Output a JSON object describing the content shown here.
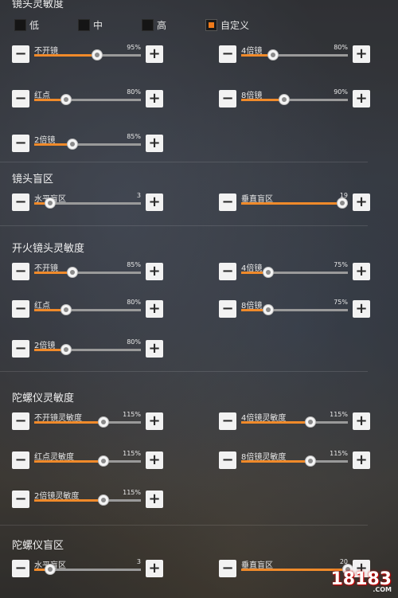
{
  "sections": {
    "scope_sensitivity": "镜头灵敏度",
    "scope_blind_zone": "镜头盲区",
    "fire_scope_sensitivity": "开火镜头灵敏度",
    "gyro_sensitivity": "陀螺仪灵敏度",
    "gyro_blind_zone": "陀螺仪盲区"
  },
  "presets": [
    {
      "label": "低",
      "selected": false
    },
    {
      "label": "中",
      "selected": false
    },
    {
      "label": "高",
      "selected": false
    },
    {
      "label": "自定义",
      "selected": true
    }
  ],
  "sliders": {
    "s1_no_scope": {
      "label": "不开镜",
      "value": "95%",
      "level": 0.59
    },
    "s1_4x": {
      "label": "4倍镜",
      "value": "80%",
      "level": 0.3
    },
    "s1_red_dot": {
      "label": "红点",
      "value": "80%",
      "level": 0.3
    },
    "s1_8x": {
      "label": "8倍镜",
      "value": "90%",
      "level": 0.4
    },
    "s1_2x": {
      "label": "2倍镜",
      "value": "85%",
      "level": 0.36
    },
    "s2_horizontal": {
      "label": "水平盲区",
      "value": "3",
      "level": 0.15
    },
    "s2_vertical": {
      "label": "垂直盲区",
      "value": "19",
      "level": 0.95
    },
    "s3_no_scope": {
      "label": "不开镜",
      "value": "85%",
      "level": 0.36
    },
    "s3_4x": {
      "label": "4倍镜",
      "value": "75%",
      "level": 0.25
    },
    "s3_red_dot": {
      "label": "红点",
      "value": "80%",
      "level": 0.3
    },
    "s3_8x": {
      "label": "8倍镜",
      "value": "75%",
      "level": 0.25
    },
    "s3_2x": {
      "label": "2倍镜",
      "value": "80%",
      "level": 0.3
    },
    "s4_no_scope": {
      "label": "不开镜灵敏度",
      "value": "115%",
      "level": 0.65
    },
    "s4_4x": {
      "label": "4倍镜灵敏度",
      "value": "115%",
      "level": 0.65
    },
    "s4_red_dot": {
      "label": "红点灵敏度",
      "value": "115%",
      "level": 0.65
    },
    "s4_8x": {
      "label": "8倍镜灵敏度",
      "value": "115%",
      "level": 0.65
    },
    "s4_2x": {
      "label": "2倍镜灵敏度",
      "value": "115%",
      "level": 0.65
    },
    "s5_horizontal": {
      "label": "水平盲区",
      "value": "3",
      "level": 0.15
    },
    "s5_vertical": {
      "label": "垂直盲区",
      "value": "20",
      "level": 1.0
    }
  },
  "controls": {
    "minus": "−",
    "plus": "+"
  },
  "accent_color": "#f08a2a",
  "watermark": {
    "logo": "18183",
    "site": ".COM"
  }
}
